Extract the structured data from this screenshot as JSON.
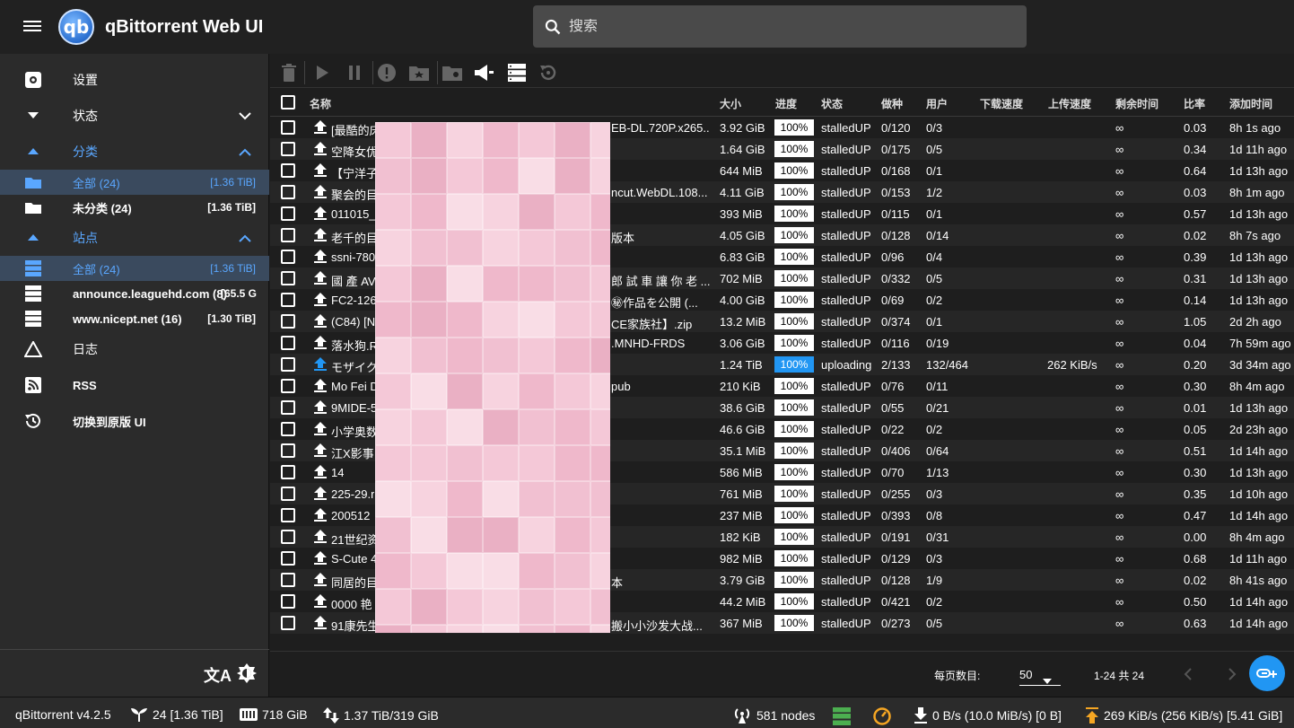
{
  "app": {
    "title": "qBittorrent Web UI",
    "logo_text": "qb"
  },
  "search": {
    "placeholder": "搜索"
  },
  "sidebar": {
    "settings": "设置",
    "status": "状态",
    "categories_header": "分类",
    "categories": [
      {
        "label": "全部 (24)",
        "size": "[1.36 TiB]"
      },
      {
        "label": "未分类 (24)",
        "size": "[1.36 TiB]"
      }
    ],
    "sites_header": "站点",
    "sites": [
      {
        "label": "全部 (24)",
        "size": "[1.36 TiB]"
      },
      {
        "label": "announce.leaguehd.com (8)",
        "size": "[65.5 G"
      },
      {
        "label": "www.nicept.net (16)",
        "size": "[1.30 TiB]"
      }
    ],
    "log": "日志",
    "rss": "RSS",
    "switch_ui": "切换到原版 UI"
  },
  "table": {
    "headers": {
      "name": "名称",
      "size": "大小",
      "progress": "进度",
      "state": "状态",
      "seeds": "做种",
      "peers": "用户",
      "dl_speed": "下载速度",
      "up_speed": "上传速度",
      "eta": "剩余时间",
      "ratio": "比率",
      "added": "添加时间"
    },
    "rows": [
      {
        "name": "[最酷的床",
        "tail": "EB-DL.720P.x265....",
        "size": "3.92 GiB",
        "progress": "100%",
        "state": "stalledUP",
        "seeds": "0/120",
        "peers": "0/3",
        "up": "",
        "eta": "∞",
        "ratio": "0.03",
        "added": "8h 1s ago"
      },
      {
        "name": "空降女优",
        "tail": "",
        "size": "1.64 GiB",
        "progress": "100%",
        "state": "stalledUP",
        "seeds": "0/175",
        "peers": "0/5",
        "up": "",
        "eta": "∞",
        "ratio": "0.34",
        "added": "1d 11h ago"
      },
      {
        "name": "【宁洋子",
        "tail": "",
        "size": "644 MiB",
        "progress": "100%",
        "state": "stalledUP",
        "seeds": "0/168",
        "peers": "0/1",
        "up": "",
        "eta": "∞",
        "ratio": "0.64",
        "added": "1d 13h ago"
      },
      {
        "name": "聚会的目",
        "tail": "ncut.WebDL.108...",
        "size": "4.11 GiB",
        "progress": "100%",
        "state": "stalledUP",
        "seeds": "0/153",
        "peers": "1/2",
        "up": "",
        "eta": "∞",
        "ratio": "0.03",
        "added": "8h 1m ago"
      },
      {
        "name": "011015_",
        "tail": "",
        "size": "393 MiB",
        "progress": "100%",
        "state": "stalledUP",
        "seeds": "0/115",
        "peers": "0/1",
        "up": "",
        "eta": "∞",
        "ratio": "0.57",
        "added": "1d 13h ago"
      },
      {
        "name": "老千的目",
        "tail": "版本",
        "size": "4.05 GiB",
        "progress": "100%",
        "state": "stalledUP",
        "seeds": "0/128",
        "peers": "0/14",
        "up": "",
        "eta": "∞",
        "ratio": "0.02",
        "added": "8h 7s ago"
      },
      {
        "name": "ssni-780",
        "tail": "",
        "size": "6.83 GiB",
        "progress": "100%",
        "state": "stalledUP",
        "seeds": "0/96",
        "peers": "0/4",
        "up": "",
        "eta": "∞",
        "ratio": "0.39",
        "added": "1d 13h ago"
      },
      {
        "name": "國 產 AV",
        "tail": "郎 試 車 讓 你 老 ...",
        "size": "702 MiB",
        "progress": "100%",
        "state": "stalledUP",
        "seeds": "0/332",
        "peers": "0/5",
        "up": "",
        "eta": "∞",
        "ratio": "0.31",
        "added": "1d 13h ago"
      },
      {
        "name": "FC2-126",
        "tail": "㊙作品を公開 (...",
        "size": "4.00 GiB",
        "progress": "100%",
        "state": "stalledUP",
        "seeds": "0/69",
        "peers": "0/2",
        "up": "",
        "eta": "∞",
        "ratio": "0.14",
        "added": "1d 13h ago"
      },
      {
        "name": "(C84) [N",
        "tail": "CE家族社】.zip",
        "size": "13.2 MiB",
        "progress": "100%",
        "state": "stalledUP",
        "seeds": "0/374",
        "peers": "0/1",
        "up": "",
        "eta": "∞",
        "ratio": "1.05",
        "added": "2d 2h ago"
      },
      {
        "name": "落水狗.R",
        "tail": ".MNHD-FRDS",
        "size": "3.06 GiB",
        "progress": "100%",
        "state": "stalledUP",
        "seeds": "0/116",
        "peers": "0/19",
        "up": "",
        "eta": "∞",
        "ratio": "0.04",
        "added": "7h 59m ago"
      },
      {
        "name": "モザイク",
        "tail": "",
        "size": "1.24 TiB",
        "progress": "100%",
        "state": "uploading",
        "seeds": "2/133",
        "peers": "132/464",
        "up": "262 KiB/s",
        "eta": "∞",
        "ratio": "0.20",
        "added": "3d 34m ago"
      },
      {
        "name": "Mo Fei D",
        "tail": "pub",
        "size": "210 KiB",
        "progress": "100%",
        "state": "stalledUP",
        "seeds": "0/76",
        "peers": "0/11",
        "up": "",
        "eta": "∞",
        "ratio": "0.30",
        "added": "8h 4m ago"
      },
      {
        "name": "9MIDE-5",
        "tail": "",
        "size": "38.6 GiB",
        "progress": "100%",
        "state": "stalledUP",
        "seeds": "0/55",
        "peers": "0/21",
        "up": "",
        "eta": "∞",
        "ratio": "0.01",
        "added": "1d 13h ago"
      },
      {
        "name": "小学奥数",
        "tail": "",
        "size": "46.6 GiB",
        "progress": "100%",
        "state": "stalledUP",
        "seeds": "0/22",
        "peers": "0/2",
        "up": "",
        "eta": "∞",
        "ratio": "0.05",
        "added": "2d 23h ago"
      },
      {
        "name": "江X影事",
        "tail": "",
        "size": "35.1 MiB",
        "progress": "100%",
        "state": "stalledUP",
        "seeds": "0/406",
        "peers": "0/64",
        "up": "",
        "eta": "∞",
        "ratio": "0.51",
        "added": "1d 14h ago"
      },
      {
        "name": "14",
        "tail": "",
        "size": "586 MiB",
        "progress": "100%",
        "state": "stalledUP",
        "seeds": "0/70",
        "peers": "1/13",
        "up": "",
        "eta": "∞",
        "ratio": "0.30",
        "added": "1d 13h ago"
      },
      {
        "name": "225-29.r",
        "tail": "",
        "size": "761 MiB",
        "progress": "100%",
        "state": "stalledUP",
        "seeds": "0/255",
        "peers": "0/3",
        "up": "",
        "eta": "∞",
        "ratio": "0.35",
        "added": "1d 10h ago"
      },
      {
        "name": "200512",
        "tail": "",
        "size": "237 MiB",
        "progress": "100%",
        "state": "stalledUP",
        "seeds": "0/393",
        "peers": "0/8",
        "up": "",
        "eta": "∞",
        "ratio": "0.47",
        "added": "1d 14h ago"
      },
      {
        "name": "21世纪资",
        "tail": "",
        "size": "182 KiB",
        "progress": "100%",
        "state": "stalledUP",
        "seeds": "0/191",
        "peers": "0/31",
        "up": "",
        "eta": "∞",
        "ratio": "0.00",
        "added": "8h 4m ago"
      },
      {
        "name": "S-Cute 4",
        "tail": "",
        "size": "982 MiB",
        "progress": "100%",
        "state": "stalledUP",
        "seeds": "0/129",
        "peers": "0/3",
        "up": "",
        "eta": "∞",
        "ratio": "0.68",
        "added": "1d 11h ago"
      },
      {
        "name": "同居的目",
        "tail": "本",
        "size": "3.79 GiB",
        "progress": "100%",
        "state": "stalledUP",
        "seeds": "0/128",
        "peers": "1/9",
        "up": "",
        "eta": "∞",
        "ratio": "0.02",
        "added": "8h 41s ago"
      },
      {
        "name": "0000 艳",
        "tail": "",
        "size": "44.2 MiB",
        "progress": "100%",
        "state": "stalledUP",
        "seeds": "0/421",
        "peers": "0/2",
        "up": "",
        "eta": "∞",
        "ratio": "0.50",
        "added": "1d 14h ago"
      },
      {
        "name": "91康先生",
        "tail": "搬小小沙发大战...",
        "size": "367 MiB",
        "progress": "100%",
        "state": "stalledUP",
        "seeds": "0/273",
        "peers": "0/5",
        "up": "",
        "eta": "∞",
        "ratio": "0.63",
        "added": "1d 14h ago"
      }
    ]
  },
  "pager": {
    "per_page_label": "每页数目:",
    "per_page": "50",
    "range": "1-24 共 24"
  },
  "status": {
    "version": "qBittorrent v4.2.5",
    "torrents": "24 [1.36 TiB]",
    "free": "718 GiB",
    "alltime": "1.37 TiB/319 GiB",
    "dht": "581 nodes",
    "download": "0 B/s (10.0 MiB/s) [0 B]",
    "upload": "269 KiB/s (256 KiB/s) [5.41 GiB]"
  },
  "colors": {
    "accent": "#2196f3",
    "upload_orange": "#f5a623",
    "green": "#4caf50"
  }
}
